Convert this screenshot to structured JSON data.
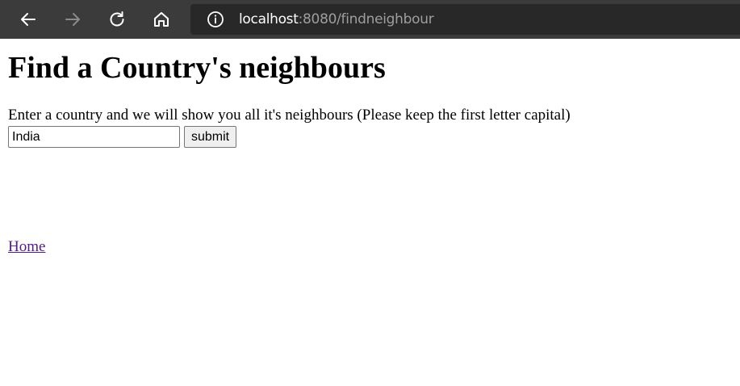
{
  "browser": {
    "url_host": "localhost",
    "url_rest": ":8080/findneighbour",
    "icons": [
      "back-arrow-icon",
      "forward-arrow-icon",
      "reload-icon",
      "home-icon",
      "info-icon"
    ]
  },
  "page": {
    "title": "Find a Country's neighbours",
    "description": "Enter a country and we will show you all it's neighbours (Please keep the first letter capital)",
    "input_value": "India",
    "submit_label": "submit",
    "home_link": "Home"
  },
  "colors": {
    "toolbar_bg": "#3b3b3b",
    "addressbar_bg": "#282828",
    "visited_link": "#551a8b"
  }
}
